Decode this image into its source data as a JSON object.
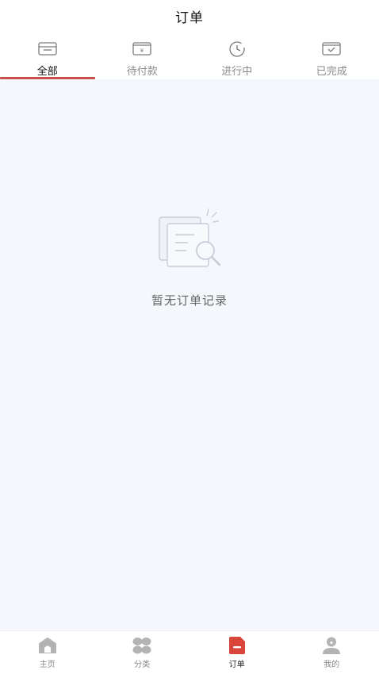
{
  "header": {
    "title": "订单"
  },
  "tabs": [
    {
      "label": "全部",
      "icon": "card-icon"
    },
    {
      "label": "待付款",
      "icon": "yen-card-icon"
    },
    {
      "label": "进行中",
      "icon": "clock-icon"
    },
    {
      "label": "已完成",
      "icon": "check-card-icon"
    }
  ],
  "empty_state": {
    "message": "暂无订单记录",
    "icon": "document-search-icon"
  },
  "bottom_nav": [
    {
      "label": "主页",
      "icon": "home-icon"
    },
    {
      "label": "分类",
      "icon": "category-icon"
    },
    {
      "label": "订单",
      "icon": "order-icon"
    },
    {
      "label": "我的",
      "icon": "profile-icon"
    }
  ],
  "colors": {
    "accent": "#c9504a",
    "content_bg": "#f4f7fb",
    "nav_inactive": "#b3b3b3",
    "tab_icon": "#7a7a7a"
  }
}
